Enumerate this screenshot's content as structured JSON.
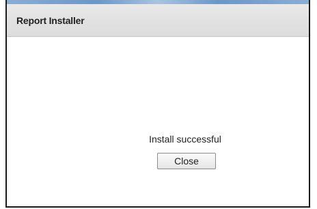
{
  "dialog": {
    "title": "Report Installer",
    "message": "Install successful",
    "close_label": "Close"
  }
}
